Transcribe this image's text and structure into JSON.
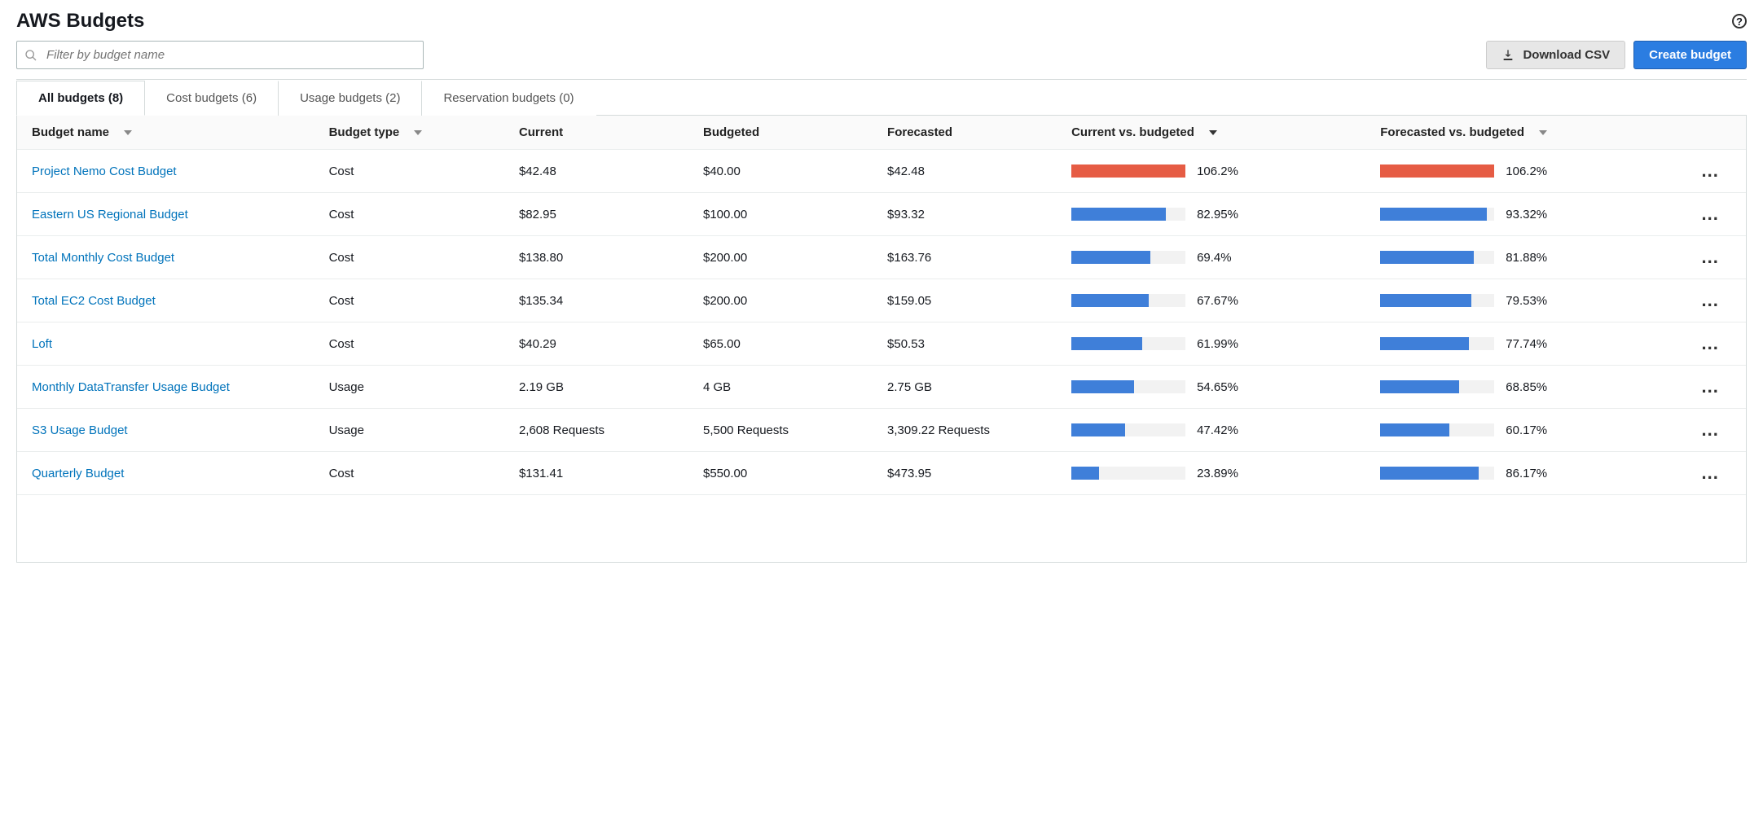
{
  "page_title": "AWS Budgets",
  "search": {
    "placeholder": "Filter by budget name"
  },
  "buttons": {
    "download": "Download CSV",
    "create": "Create budget"
  },
  "tabs": [
    {
      "label": "All budgets (8)",
      "active": true
    },
    {
      "label": "Cost budgets (6)",
      "active": false
    },
    {
      "label": "Usage budgets (2)",
      "active": false
    },
    {
      "label": "Reservation budgets (0)",
      "active": false
    }
  ],
  "columns": {
    "name": "Budget name",
    "type": "Budget type",
    "current": "Current",
    "budgeted": "Budgeted",
    "forecasted": "Forecasted",
    "cvb": "Current vs. budgeted",
    "fvb": "Forecasted vs. budgeted"
  },
  "rows": [
    {
      "name": "Project Nemo Cost Budget",
      "type": "Cost",
      "current": "$42.48",
      "budgeted": "$40.00",
      "forecasted": "$42.48",
      "cvb_pct": "106.2%",
      "cvb_val": 106.2,
      "fvb_pct": "106.2%",
      "fvb_val": 106.2
    },
    {
      "name": "Eastern US Regional Budget",
      "type": "Cost",
      "current": "$82.95",
      "budgeted": "$100.00",
      "forecasted": "$93.32",
      "cvb_pct": "82.95%",
      "cvb_val": 82.95,
      "fvb_pct": "93.32%",
      "fvb_val": 93.32
    },
    {
      "name": "Total Monthly Cost Budget",
      "type": "Cost",
      "current": "$138.80",
      "budgeted": "$200.00",
      "forecasted": "$163.76",
      "cvb_pct": "69.4%",
      "cvb_val": 69.4,
      "fvb_pct": "81.88%",
      "fvb_val": 81.88
    },
    {
      "name": "Total EC2 Cost Budget",
      "type": "Cost",
      "current": "$135.34",
      "budgeted": "$200.00",
      "forecasted": "$159.05",
      "cvb_pct": "67.67%",
      "cvb_val": 67.67,
      "fvb_pct": "79.53%",
      "fvb_val": 79.53
    },
    {
      "name": "Loft",
      "type": "Cost",
      "current": "$40.29",
      "budgeted": "$65.00",
      "forecasted": "$50.53",
      "cvb_pct": "61.99%",
      "cvb_val": 61.99,
      "fvb_pct": "77.74%",
      "fvb_val": 77.74
    },
    {
      "name": "Monthly DataTransfer Usage Budget",
      "type": "Usage",
      "current": "2.19 GB",
      "budgeted": "4 GB",
      "forecasted": "2.75 GB",
      "cvb_pct": "54.65%",
      "cvb_val": 54.65,
      "fvb_pct": "68.85%",
      "fvb_val": 68.85
    },
    {
      "name": "S3 Usage Budget",
      "type": "Usage",
      "current": "2,608 Requests",
      "budgeted": "5,500 Requests",
      "forecasted": "3,309.22 Requests",
      "cvb_pct": "47.42%",
      "cvb_val": 47.42,
      "fvb_pct": "60.17%",
      "fvb_val": 60.17
    },
    {
      "name": "Quarterly Budget",
      "type": "Cost",
      "current": "$131.41",
      "budgeted": "$550.00",
      "forecasted": "$473.95",
      "cvb_pct": "23.89%",
      "cvb_val": 23.89,
      "fvb_pct": "86.17%",
      "fvb_val": 86.17
    }
  ],
  "colors": {
    "bar_normal": "#3f7fd9",
    "bar_over": "#e65c44",
    "link": "#0073bb",
    "primary": "#2b7de1"
  }
}
